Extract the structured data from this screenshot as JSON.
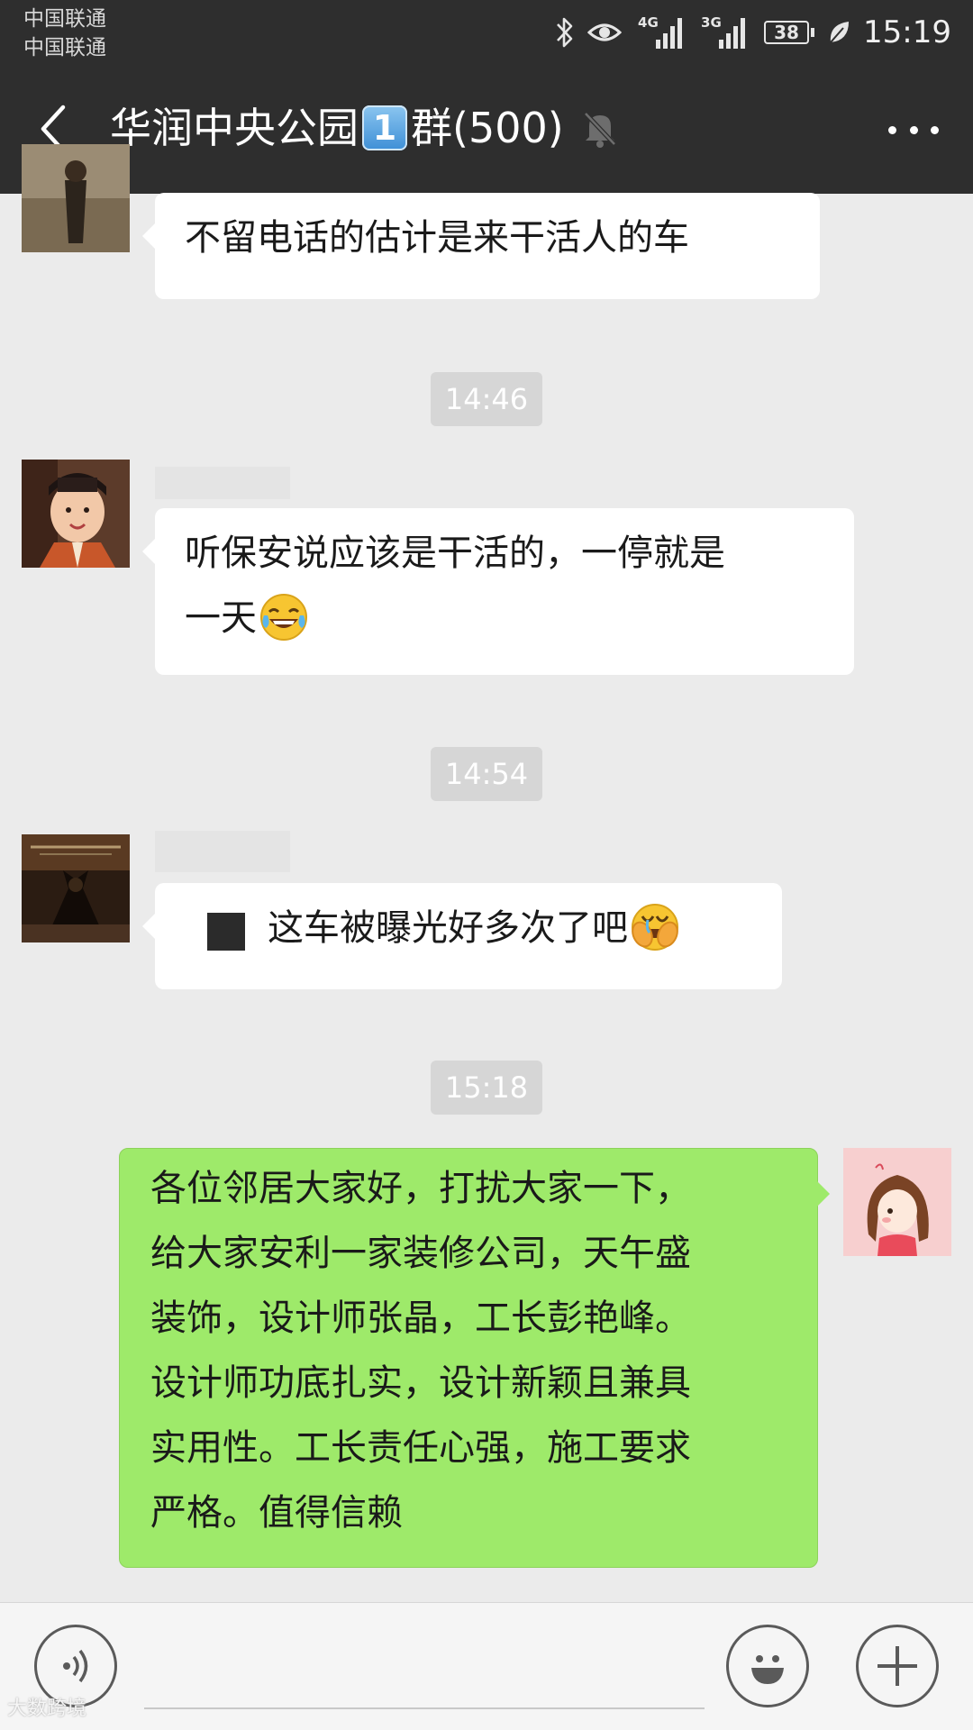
{
  "status_bar": {
    "carrier_1": "中国联通",
    "carrier_2": "中国联通",
    "network_1": "4G",
    "network_2": "3G",
    "battery": "38",
    "time": "15:19",
    "icons": [
      "bluetooth-icon",
      "eye-icon",
      "signal-4g-icon",
      "signal-3g-icon",
      "battery-icon",
      "leaf-icon"
    ]
  },
  "header": {
    "title_prefix": "华润中央公园",
    "title_badge": "1",
    "title_suffix": "群(500)",
    "icons": [
      "back-arrow-icon",
      "mute-bell-icon",
      "more-dots-icon"
    ]
  },
  "messages": [
    {
      "type": "text",
      "side": "left",
      "text": "不留电话的估计是来干活人的车"
    },
    {
      "type": "time",
      "text": "14:46"
    },
    {
      "type": "text",
      "side": "left",
      "text_line1": "听保安说应该是干活的，一停就是",
      "text_line2": "一天",
      "emoji": "tears-of-joy-emoji"
    },
    {
      "type": "time",
      "text": "14:54"
    },
    {
      "type": "text",
      "side": "left",
      "text": "这车被曝光好多次了吧",
      "emoji": "crying-laughing-emoji"
    },
    {
      "type": "time",
      "text": "15:18"
    },
    {
      "type": "text",
      "side": "right",
      "lines": [
        "各位邻居大家好，打扰大家一下，",
        "给大家安利一家装修公司，天午盛",
        "装饰，设计师张晶，工长彭艳峰。",
        "设计师功底扎实，设计新颖且兼具",
        "实用性。工长责任心强，施工要求",
        "严格。值得信赖"
      ]
    }
  ],
  "input_bar": {
    "icons": [
      "voice-icon",
      "emoji-icon",
      "plus-icon"
    ]
  },
  "watermark": "大数跨境",
  "colors": {
    "header_bg": "#2e2e2e",
    "chat_bg": "#ebebeb",
    "bubble_left": "#ffffff",
    "bubble_right": "#9eea6a",
    "timestamp_bg": "#d6d6d6"
  }
}
